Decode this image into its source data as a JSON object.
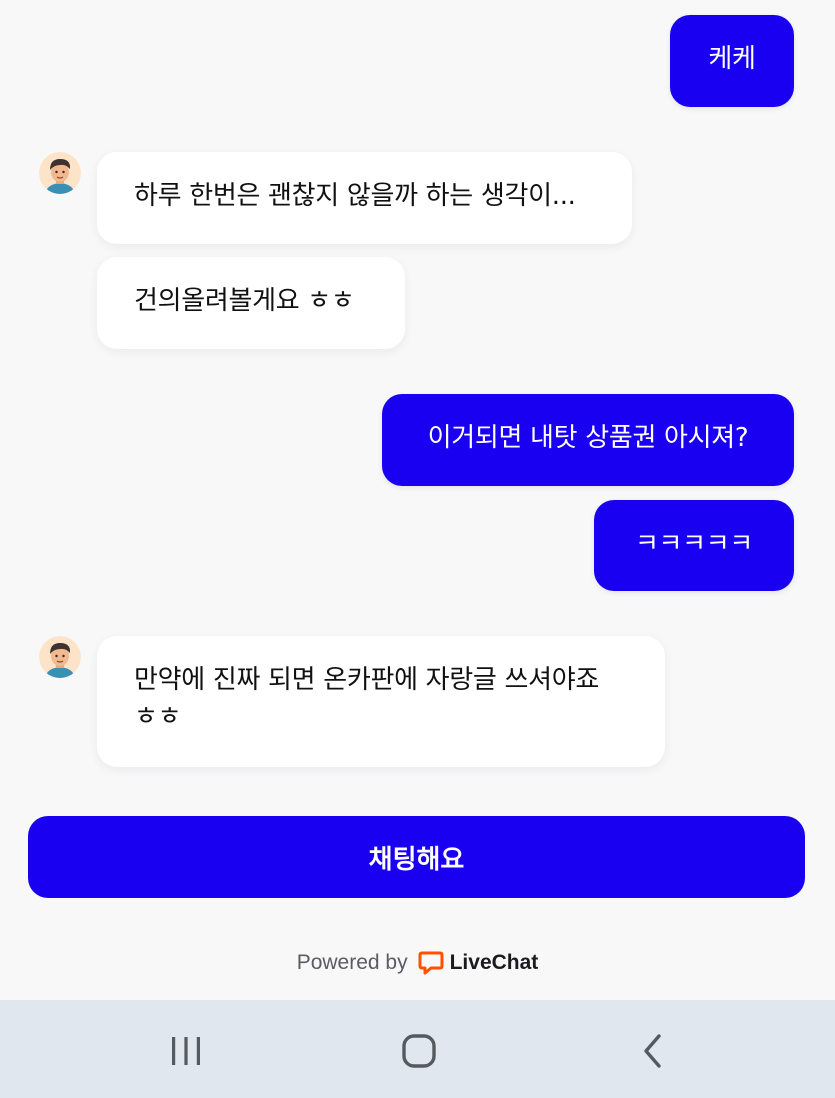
{
  "messages": [
    {
      "from": "user",
      "text": "케케"
    },
    {
      "from": "agent",
      "text": "하루 한번은 괜찮지 않을까 하는 생각이..."
    },
    {
      "from": "agent",
      "text": "건의올려볼게요 ㅎㅎ"
    },
    {
      "from": "user",
      "text": "이거되면 내탓 상품권 아시져?"
    },
    {
      "from": "user",
      "text": "ㅋㅋㅋㅋㅋ"
    },
    {
      "from": "agent",
      "text": "만약에 진짜 되면 온카판에 자랑글 쓰셔야죠 ㅎㅎ"
    }
  ],
  "chat_button": {
    "label": "채팅해요"
  },
  "footer": {
    "powered_label": "Powered by",
    "brand": "LiveChat",
    "brand_color": "#ff5100"
  },
  "colors": {
    "accent": "#1a00f0",
    "background": "#f8f8f9",
    "navbar": "#e1e7ef"
  },
  "navbar": {
    "recent_apps_icon": "recent-apps-icon",
    "home_icon": "home-icon",
    "back_icon": "back-icon"
  }
}
